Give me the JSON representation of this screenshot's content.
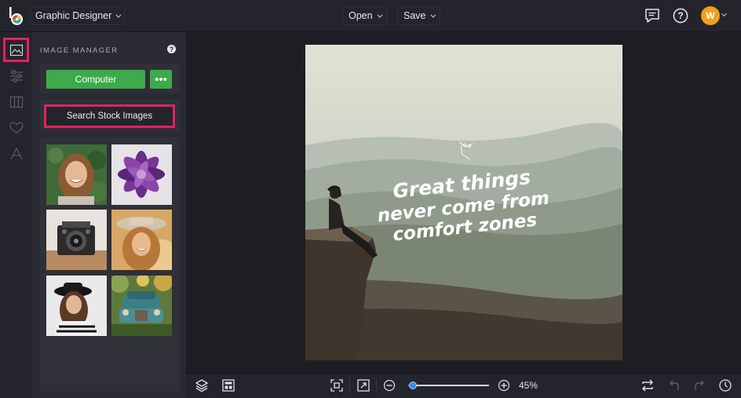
{
  "topbar": {
    "app_name": "Graphic Designer",
    "open_label": "Open",
    "save_label": "Save",
    "user_initial": "W",
    "icons": [
      "logo-icon",
      "comments-icon",
      "help-icon",
      "chevron-down-icon"
    ]
  },
  "rail": {
    "items": [
      {
        "name": "image-manager",
        "icon": "image-icon",
        "active": true
      },
      {
        "name": "adjustments",
        "icon": "sliders-icon",
        "active": false
      },
      {
        "name": "layouts",
        "icon": "columns-icon",
        "active": false
      },
      {
        "name": "favorites",
        "icon": "heart-icon",
        "active": false
      },
      {
        "name": "text",
        "icon": "text-a-icon",
        "active": false
      }
    ]
  },
  "panel": {
    "title": "IMAGE MANAGER",
    "help_symbol": "?",
    "computer_label": "Computer",
    "more_label": "•••",
    "search_label": "Search Stock Images",
    "thumbnails": [
      {
        "name": "woman-smiling"
      },
      {
        "name": "purple-succulent"
      },
      {
        "name": "vintage-camera"
      },
      {
        "name": "woman-hat-sun"
      },
      {
        "name": "woman-black-hat"
      },
      {
        "name": "vintage-truck"
      }
    ]
  },
  "canvas": {
    "quote_lines": [
      "Great things",
      "never come from",
      "comfort zones"
    ]
  },
  "bottombar": {
    "zoom_percent_value": 45,
    "zoom_label": "45%",
    "icons": [
      "layers-icon",
      "layout-icon",
      "fit-screen-icon",
      "expand-icon",
      "zoom-out-icon",
      "zoom-in-icon",
      "swap-icon",
      "undo-icon",
      "redo-icon",
      "history-icon"
    ]
  },
  "colors": {
    "accent_green": "#3daa4b",
    "highlight_pink": "#e5215e",
    "zoom_blue": "#3a8ee6",
    "avatar_orange": "#f0a01a"
  }
}
